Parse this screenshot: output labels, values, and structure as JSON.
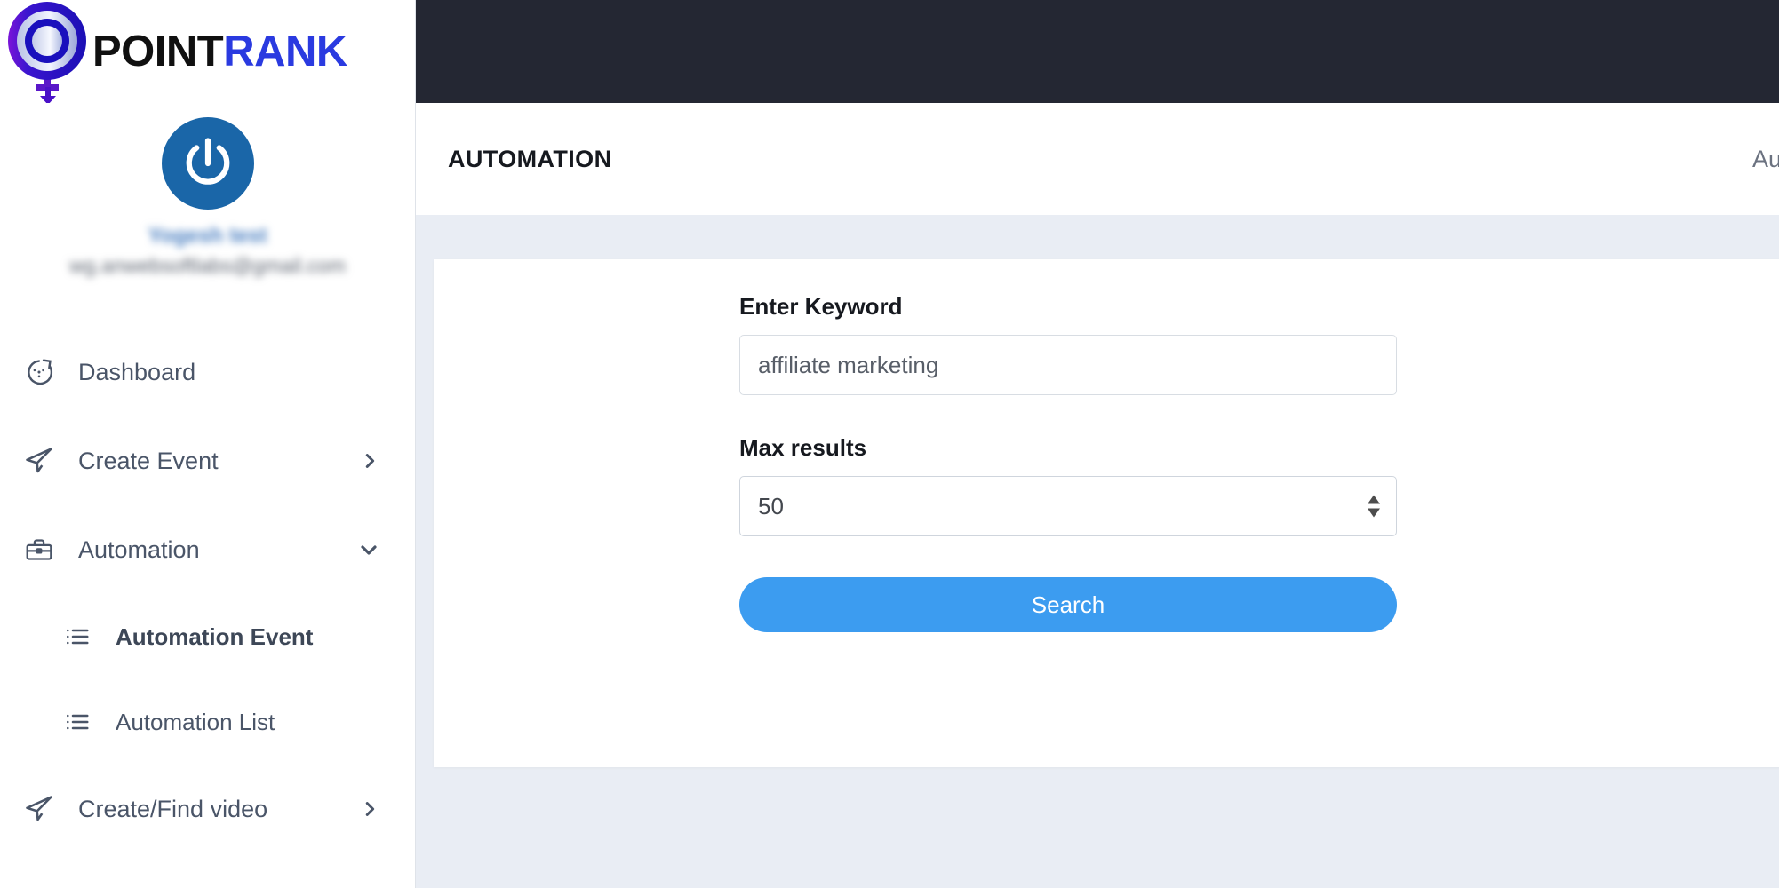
{
  "brand": {
    "name_part1": "POINT",
    "name_part2": "RANK",
    "logo_icon": "pointrank-target-pin-logo"
  },
  "profile": {
    "avatar_icon": "power-button-avatar-icon",
    "name": "Yogesh test",
    "email": "wg.anwebsoftlabs@gmail.com"
  },
  "sidebar": {
    "items": [
      {
        "label": "Dashboard",
        "icon": "stopwatch-icon",
        "has_caret": false
      },
      {
        "label": "Create Event",
        "icon": "send-plane-icon",
        "has_caret": true,
        "caret": "chevron-right-icon"
      },
      {
        "label": "Automation",
        "icon": "briefcase-icon",
        "has_caret": true,
        "caret": "chevron-down-icon",
        "expanded": true
      },
      {
        "label": "Create/Find video",
        "icon": "send-plane-icon",
        "has_caret": true,
        "caret": "chevron-right-icon"
      }
    ],
    "automation_subitems": [
      {
        "label": "Automation Event",
        "icon": "list-icon",
        "active": true
      },
      {
        "label": "Automation List",
        "icon": "list-icon",
        "active": false
      }
    ]
  },
  "page_header": {
    "title": "AUTOMATION",
    "breadcrumb": "Automation"
  },
  "form": {
    "keyword_label": "Enter Keyword",
    "keyword_value": "affiliate marketing",
    "keyword_placeholder": "Enter Keyword",
    "max_results_label": "Max results",
    "max_results_value": "50",
    "search_button": "Search"
  },
  "colors": {
    "topbar": "#242733",
    "page_bg": "#e9edf4",
    "primary_button": "#3c9cf0",
    "brand_blue": "#2a3ae0",
    "nav_text": "#4a5568",
    "avatar_blue": "#1a66a8"
  }
}
